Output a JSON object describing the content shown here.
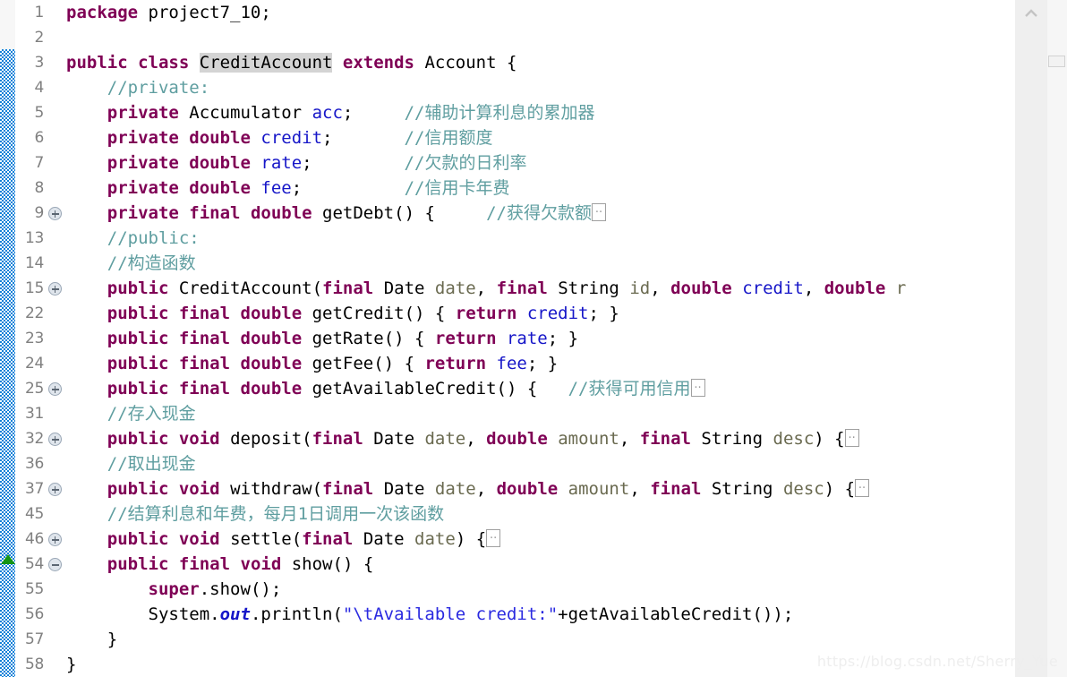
{
  "editor": {
    "language": "java",
    "first_line_top": 0,
    "line_height": 28,
    "colors": {
      "keyword": "#7f0055",
      "comment": "#5f9ea0",
      "field": "#1616c8",
      "string": "#2a2ae0",
      "parameter": "#6a6a50",
      "plain": "#000000",
      "change_bar": "#0f80d8",
      "marker_green": "#149414",
      "highlight": "#d4d4d4",
      "gutter_number": "#808080"
    }
  },
  "watermark": {
    "text": "https://blog.csdn.net/Sherry_Yue"
  },
  "scrollbar": {
    "up_arrow_icon": "chevron-up-icon",
    "overview_marker_icon": "overview-marker"
  },
  "gutter": {
    "rows": [
      {
        "num": "1",
        "fold": "none"
      },
      {
        "num": "2",
        "fold": "none"
      },
      {
        "num": "3",
        "fold": "none"
      },
      {
        "num": "4",
        "fold": "none"
      },
      {
        "num": "5",
        "fold": "none"
      },
      {
        "num": "6",
        "fold": "none"
      },
      {
        "num": "7",
        "fold": "none"
      },
      {
        "num": "8",
        "fold": "none"
      },
      {
        "num": "9",
        "fold": "plus"
      },
      {
        "num": "13",
        "fold": "none"
      },
      {
        "num": "14",
        "fold": "none"
      },
      {
        "num": "15",
        "fold": "plus"
      },
      {
        "num": "22",
        "fold": "none"
      },
      {
        "num": "23",
        "fold": "none"
      },
      {
        "num": "24",
        "fold": "none"
      },
      {
        "num": "25",
        "fold": "plus"
      },
      {
        "num": "31",
        "fold": "none"
      },
      {
        "num": "32",
        "fold": "plus"
      },
      {
        "num": "36",
        "fold": "none"
      },
      {
        "num": "37",
        "fold": "plus"
      },
      {
        "num": "45",
        "fold": "none"
      },
      {
        "num": "46",
        "fold": "plus"
      },
      {
        "num": "54",
        "fold": "minus"
      },
      {
        "num": "55",
        "fold": "none"
      },
      {
        "num": "56",
        "fold": "none"
      },
      {
        "num": "57",
        "fold": "none"
      },
      {
        "num": "58",
        "fold": "none"
      }
    ]
  },
  "code": {
    "lines": [
      {
        "n": "1",
        "text": "package project7_10;"
      },
      {
        "n": "2",
        "text": ""
      },
      {
        "n": "3",
        "text": "public class CreditAccount extends Account {"
      },
      {
        "n": "4",
        "text": "    //private:"
      },
      {
        "n": "5",
        "text": "    private Accumulator acc;     //辅助计算利息的累加器"
      },
      {
        "n": "6",
        "text": "    private double credit;       //信用额度"
      },
      {
        "n": "7",
        "text": "    private double rate;         //欠款的日利率"
      },
      {
        "n": "8",
        "text": "    private double fee;          //信用卡年费"
      },
      {
        "n": "9",
        "text": "    private final double getDebt() {     //获得欠款额.."
      },
      {
        "n": "13",
        "text": "    //public:"
      },
      {
        "n": "14",
        "text": "    //构造函数"
      },
      {
        "n": "15",
        "text": "    public CreditAccount(final Date date, final String id, double credit, double r"
      },
      {
        "n": "22",
        "text": "    public final double getCredit() { return credit; }"
      },
      {
        "n": "23",
        "text": "    public final double getRate() { return rate; }"
      },
      {
        "n": "24",
        "text": "    public final double getFee() { return fee; }"
      },
      {
        "n": "25",
        "text": "    public final double getAvailableCredit() {   //获得可用信用.."
      },
      {
        "n": "31",
        "text": "    //存入现金"
      },
      {
        "n": "32",
        "text": "    public void deposit(final Date date, double amount, final String desc) {.."
      },
      {
        "n": "36",
        "text": "    //取出现金"
      },
      {
        "n": "37",
        "text": "    public void withdraw(final Date date, double amount, final String desc) {.."
      },
      {
        "n": "45",
        "text": "    //结算利息和年费，每月1日调用一次该函数"
      },
      {
        "n": "46",
        "text": "    public void settle(final Date date) {.."
      },
      {
        "n": "54",
        "text": "    public final void show() {"
      },
      {
        "n": "55",
        "text": "        super.show();"
      },
      {
        "n": "56",
        "text": "        System.out.println(\"\\tAvailable credit:\"+getAvailableCredit());"
      },
      {
        "n": "57",
        "text": "    }"
      },
      {
        "n": "58",
        "text": "}"
      }
    ]
  }
}
